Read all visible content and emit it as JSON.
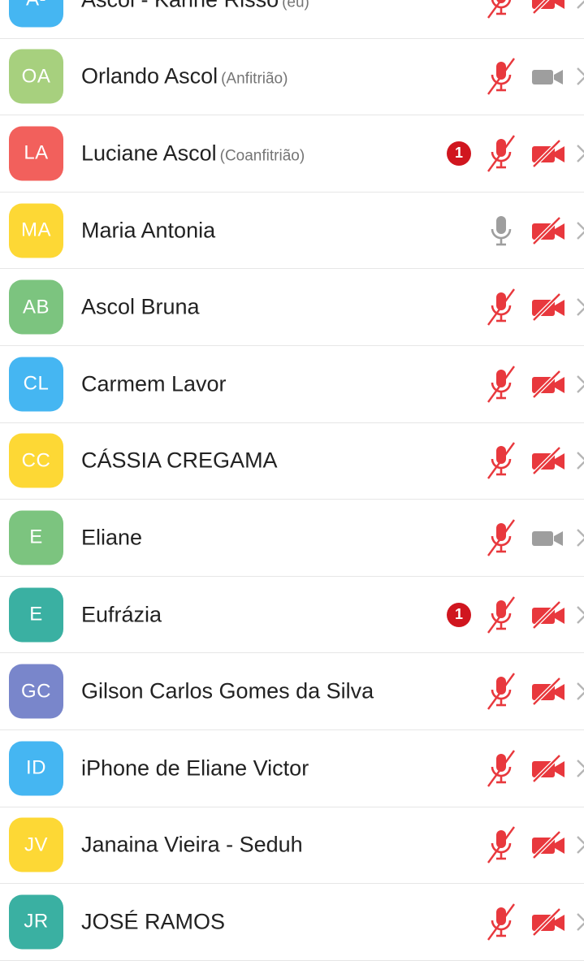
{
  "colors": {
    "muted_red": "#e8383d",
    "icon_gray": "#9e9e9e",
    "badge_red": "#d0161f"
  },
  "participants": [
    {
      "initials": "A-",
      "name": "Ascol - Karine Risso",
      "role": "(eu)",
      "avatar_color": "#45b6f2",
      "badge": null,
      "mic": "muted",
      "video": "off"
    },
    {
      "initials": "OA",
      "name": "Orlando Ascol",
      "role": "(Anfitrião)",
      "avatar_color": "#a7d07e",
      "badge": null,
      "mic": "muted",
      "video": "on"
    },
    {
      "initials": "LA",
      "name": "Luciane Ascol",
      "role": "(Coanfitrião)",
      "avatar_color": "#f2605c",
      "badge": "1",
      "mic": "muted",
      "video": "off"
    },
    {
      "initials": "MA",
      "name": "Maria Antonia",
      "role": "",
      "avatar_color": "#fdd835",
      "badge": null,
      "mic": "on",
      "video": "off"
    },
    {
      "initials": "AB",
      "name": "Ascol Bruna",
      "role": "",
      "avatar_color": "#7cc47f",
      "badge": null,
      "mic": "muted",
      "video": "off"
    },
    {
      "initials": "CL",
      "name": "Carmem Lavor",
      "role": "",
      "avatar_color": "#45b6f2",
      "badge": null,
      "mic": "muted",
      "video": "off"
    },
    {
      "initials": "CC",
      "name": "CÁSSIA CREGAMA",
      "role": "",
      "avatar_color": "#fdd835",
      "badge": null,
      "mic": "muted",
      "video": "off"
    },
    {
      "initials": "E",
      "name": "Eliane",
      "role": "",
      "avatar_color": "#7cc47f",
      "badge": null,
      "mic": "muted",
      "video": "on"
    },
    {
      "initials": "E",
      "name": "Eufrázia",
      "role": "",
      "avatar_color": "#3ab0a2",
      "badge": "1",
      "mic": "muted",
      "video": "off"
    },
    {
      "initials": "GC",
      "name": "Gilson Carlos Gomes da Silva",
      "role": "",
      "avatar_color": "#7986cb",
      "badge": null,
      "mic": "muted",
      "video": "off"
    },
    {
      "initials": "ID",
      "name": "iPhone de Eliane Victor",
      "role": "",
      "avatar_color": "#45b6f2",
      "badge": null,
      "mic": "muted",
      "video": "off"
    },
    {
      "initials": "JV",
      "name": "Janaina Vieira - Seduh",
      "role": "",
      "avatar_color": "#fdd835",
      "badge": null,
      "mic": "muted",
      "video": "off"
    },
    {
      "initials": "JR",
      "name": "JOSÉ RAMOS",
      "role": "",
      "avatar_color": "#3ab0a2",
      "badge": null,
      "mic": "muted",
      "video": "off"
    }
  ]
}
